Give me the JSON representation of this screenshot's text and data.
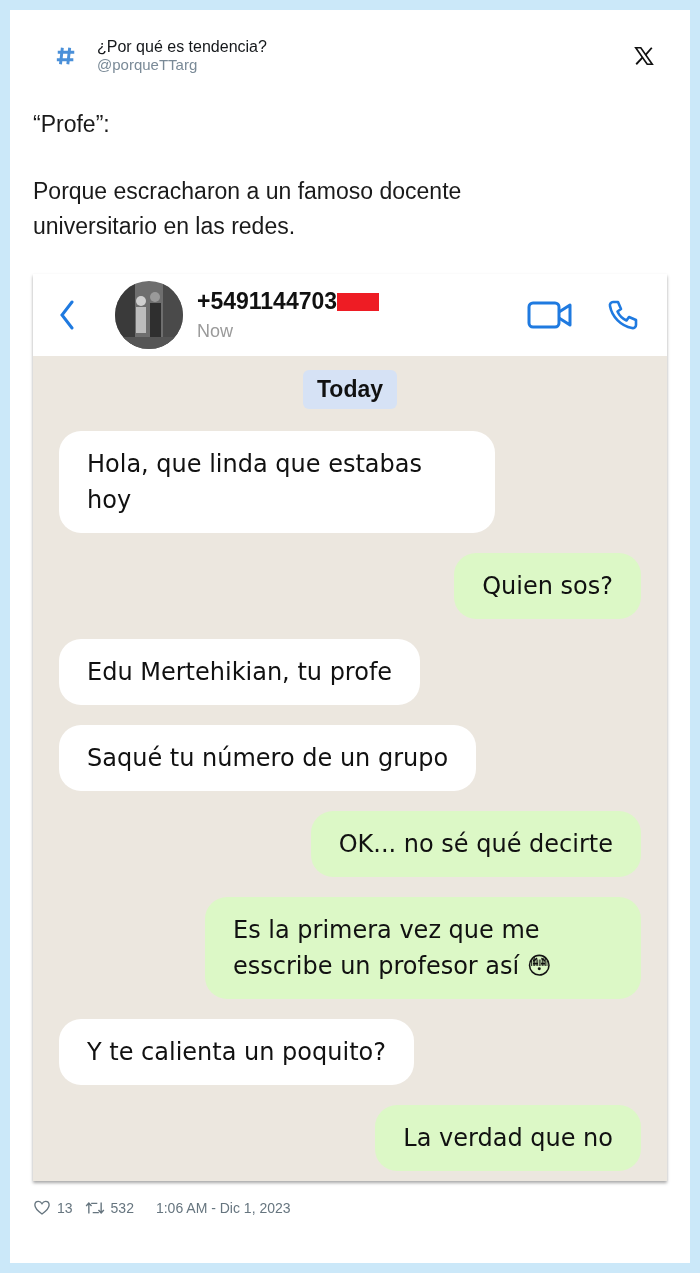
{
  "tweet": {
    "author": "¿Por qué es tendencia?",
    "handle": "@porqueTTarg",
    "paragraphs": [
      "“Profe”:",
      "Porque escracharon a un famoso docente universitario en las redes."
    ],
    "chat": {
      "contact": "+5491144703",
      "status": "Now",
      "date_chip": "Today",
      "messages": [
        {
          "kind": "in",
          "text": "Hola, que linda que estabas hoy"
        },
        {
          "kind": "out",
          "text": "Quien sos?"
        },
        {
          "kind": "in",
          "text": "Edu Mertehikian, tu profe"
        },
        {
          "kind": "in",
          "text": "Saqué tu número de un grupo"
        },
        {
          "kind": "out",
          "text": "OK... no sé qué decirte"
        },
        {
          "kind": "out",
          "text": "Es la primera vez que me esscribe un profesor así 😳"
        },
        {
          "kind": "in",
          "text": "Y te calienta un poquito?"
        },
        {
          "kind": "out",
          "text": "La verdad que no"
        }
      ]
    },
    "likes": "13",
    "retweets": "532",
    "timestamp": "1:06 AM - Dic 1, 2023"
  }
}
